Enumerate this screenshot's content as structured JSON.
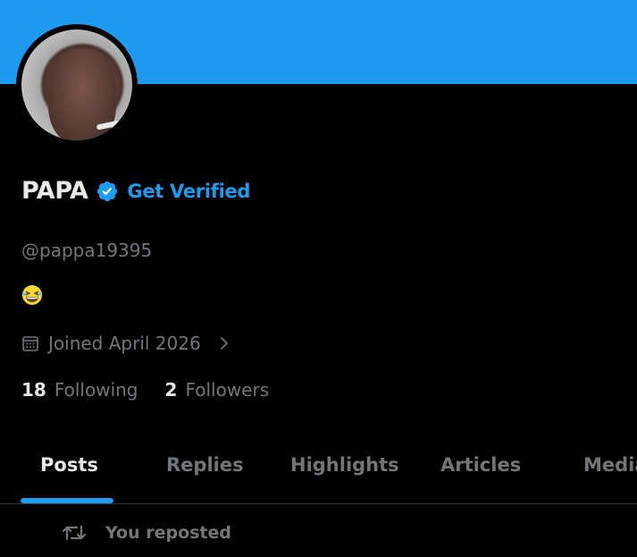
{
  "profile": {
    "name": "PAPA",
    "get_verified_label": "Get Verified",
    "handle": "@pappa19395",
    "bio_emoji_icon": "grinning-squinting-face-emoji",
    "joined_text": "Joined April 2026",
    "following_count": "18",
    "following_label": "Following",
    "followers_count": "2",
    "followers_label": "Followers"
  },
  "tabs": [
    {
      "label": "Posts",
      "active": true
    },
    {
      "label": "Replies",
      "active": false
    },
    {
      "label": "Highlights",
      "active": false
    },
    {
      "label": "Articles",
      "active": false
    },
    {
      "label": "Media",
      "active": false
    }
  ],
  "feed": {
    "repost_text": "You reposted"
  },
  "colors": {
    "banner": "#1d9bf0",
    "accent": "#1d9bf0",
    "background": "#000000",
    "text_primary": "#e7e9ea",
    "text_secondary": "#71767b"
  },
  "icons": {
    "verified": "verified-badge-icon",
    "calendar": "calendar-icon",
    "chevron": "chevron-right-icon",
    "repost": "repost-icon"
  }
}
